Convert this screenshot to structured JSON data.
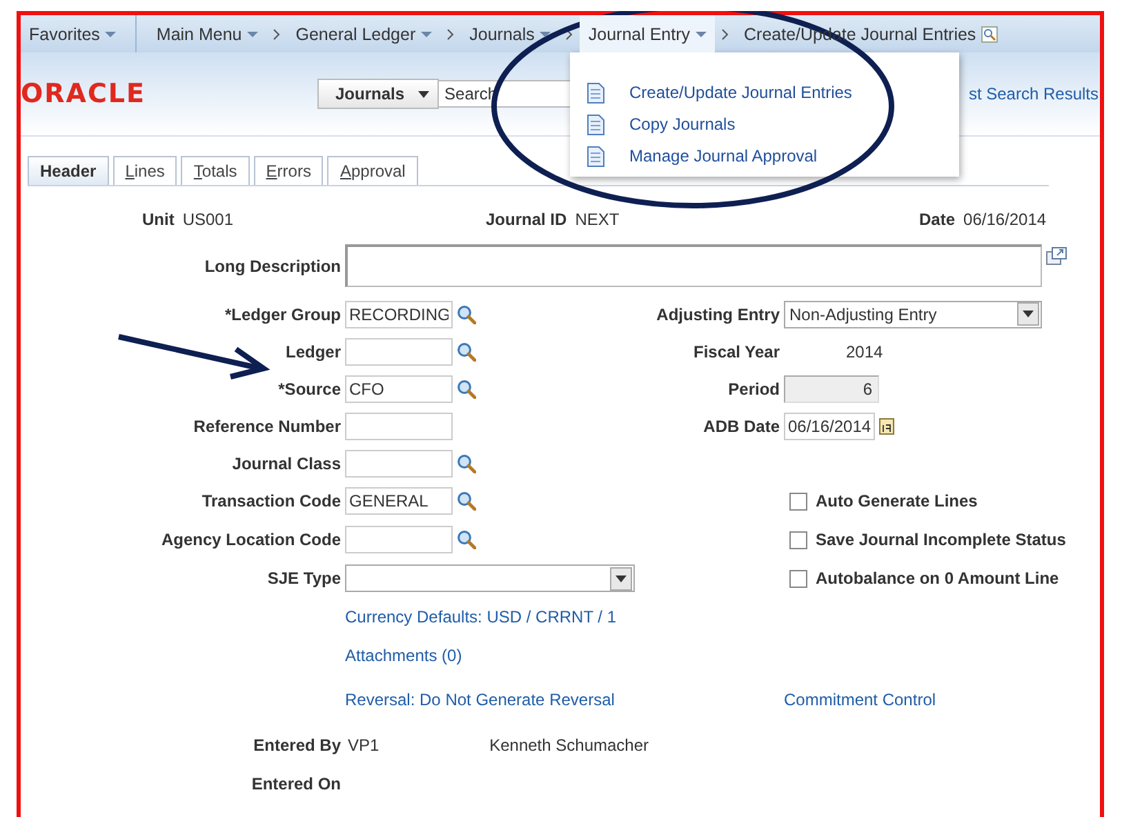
{
  "nav": {
    "favorites": "Favorites",
    "breadcrumbs": [
      {
        "label": "Main Menu",
        "has_menu": true,
        "selected": false
      },
      {
        "label": "General Ledger",
        "has_menu": true,
        "selected": false
      },
      {
        "label": "Journals",
        "has_menu": true,
        "selected": false
      },
      {
        "label": "Journal Entry",
        "has_menu": true,
        "selected": true
      },
      {
        "label": "Create/Update Journal Entries",
        "has_menu": false,
        "selected": false
      }
    ]
  },
  "menu": {
    "items": [
      {
        "label": "Create/Update Journal Entries"
      },
      {
        "label": "Copy Journals"
      },
      {
        "label": "Manage Journal Approval"
      }
    ]
  },
  "header": {
    "logo": "ORACLE",
    "search_category": "Journals",
    "search_placeholder": "Search",
    "results_link": "st Search Results"
  },
  "tabs": [
    {
      "label": "Header",
      "selected": true,
      "underline_first": false
    },
    {
      "label": "Lines",
      "selected": false,
      "underline_first": true
    },
    {
      "label": "Totals",
      "selected": false,
      "underline_first": true
    },
    {
      "label": "Errors",
      "selected": false,
      "underline_first": true
    },
    {
      "label": "Approval",
      "selected": false,
      "underline_first": true
    }
  ],
  "summary": [
    {
      "label": "Unit",
      "value": "US001"
    },
    {
      "label": "Journal ID",
      "value": "NEXT"
    },
    {
      "label": "Date",
      "value": "06/16/2014"
    }
  ],
  "form_rows": [
    {
      "left": {
        "kind": "textarea",
        "label": "Long Description"
      }
    },
    {
      "left": {
        "kind": "lookup",
        "label": "*Ledger Group",
        "value": "RECORDING"
      },
      "right": {
        "kind": "select",
        "label": "Adjusting Entry",
        "value": "Non-Adjusting Entry"
      }
    },
    {
      "left": {
        "kind": "lookup",
        "label": "Ledger"
      },
      "right": {
        "kind": "display",
        "label": "Fiscal Year",
        "value": "2014"
      }
    },
    {
      "left": {
        "kind": "lookup",
        "label": "*Source",
        "value": "CFO"
      },
      "right": {
        "kind": "readonly",
        "label": "Period",
        "value": "6"
      }
    },
    {
      "left": {
        "kind": "text",
        "label": "Reference Number"
      },
      "right": {
        "kind": "date",
        "label": "ADB Date",
        "value": "06/16/2014"
      }
    },
    {
      "left": {
        "kind": "lookup",
        "label": "Journal Class"
      }
    },
    {
      "left": {
        "kind": "lookup",
        "label": "Transaction Code",
        "value": "GENERAL"
      },
      "right": {
        "kind": "checkbox",
        "label": "Auto Generate Lines",
        "checked": false
      }
    },
    {
      "left": {
        "kind": "lookup",
        "label": "Agency Location Code"
      },
      "right": {
        "kind": "checkbox",
        "label": "Save Journal Incomplete Status",
        "checked": false
      }
    },
    {
      "left": {
        "kind": "select",
        "label": "SJE Type"
      },
      "right": {
        "kind": "checkbox",
        "label": "Autobalance on 0 Amount Line",
        "checked": false
      }
    },
    {
      "left": {
        "kind": "link",
        "label": "Currency Defaults: USD / CRRNT / 1"
      }
    },
    {
      "left": {
        "kind": "link",
        "label": "Attachments (0)"
      }
    },
    {
      "left": {
        "kind": "link",
        "label": "Reversal: Do Not Generate Reversal"
      },
      "right": {
        "kind": "link",
        "label": "Commitment Control"
      }
    },
    {
      "left": {
        "kind": "display",
        "label": "Entered By",
        "value": "VP1",
        "extra": "Kenneth Schumacher"
      }
    },
    {
      "left": {
        "kind": "display",
        "label": "Entered On"
      }
    }
  ]
}
